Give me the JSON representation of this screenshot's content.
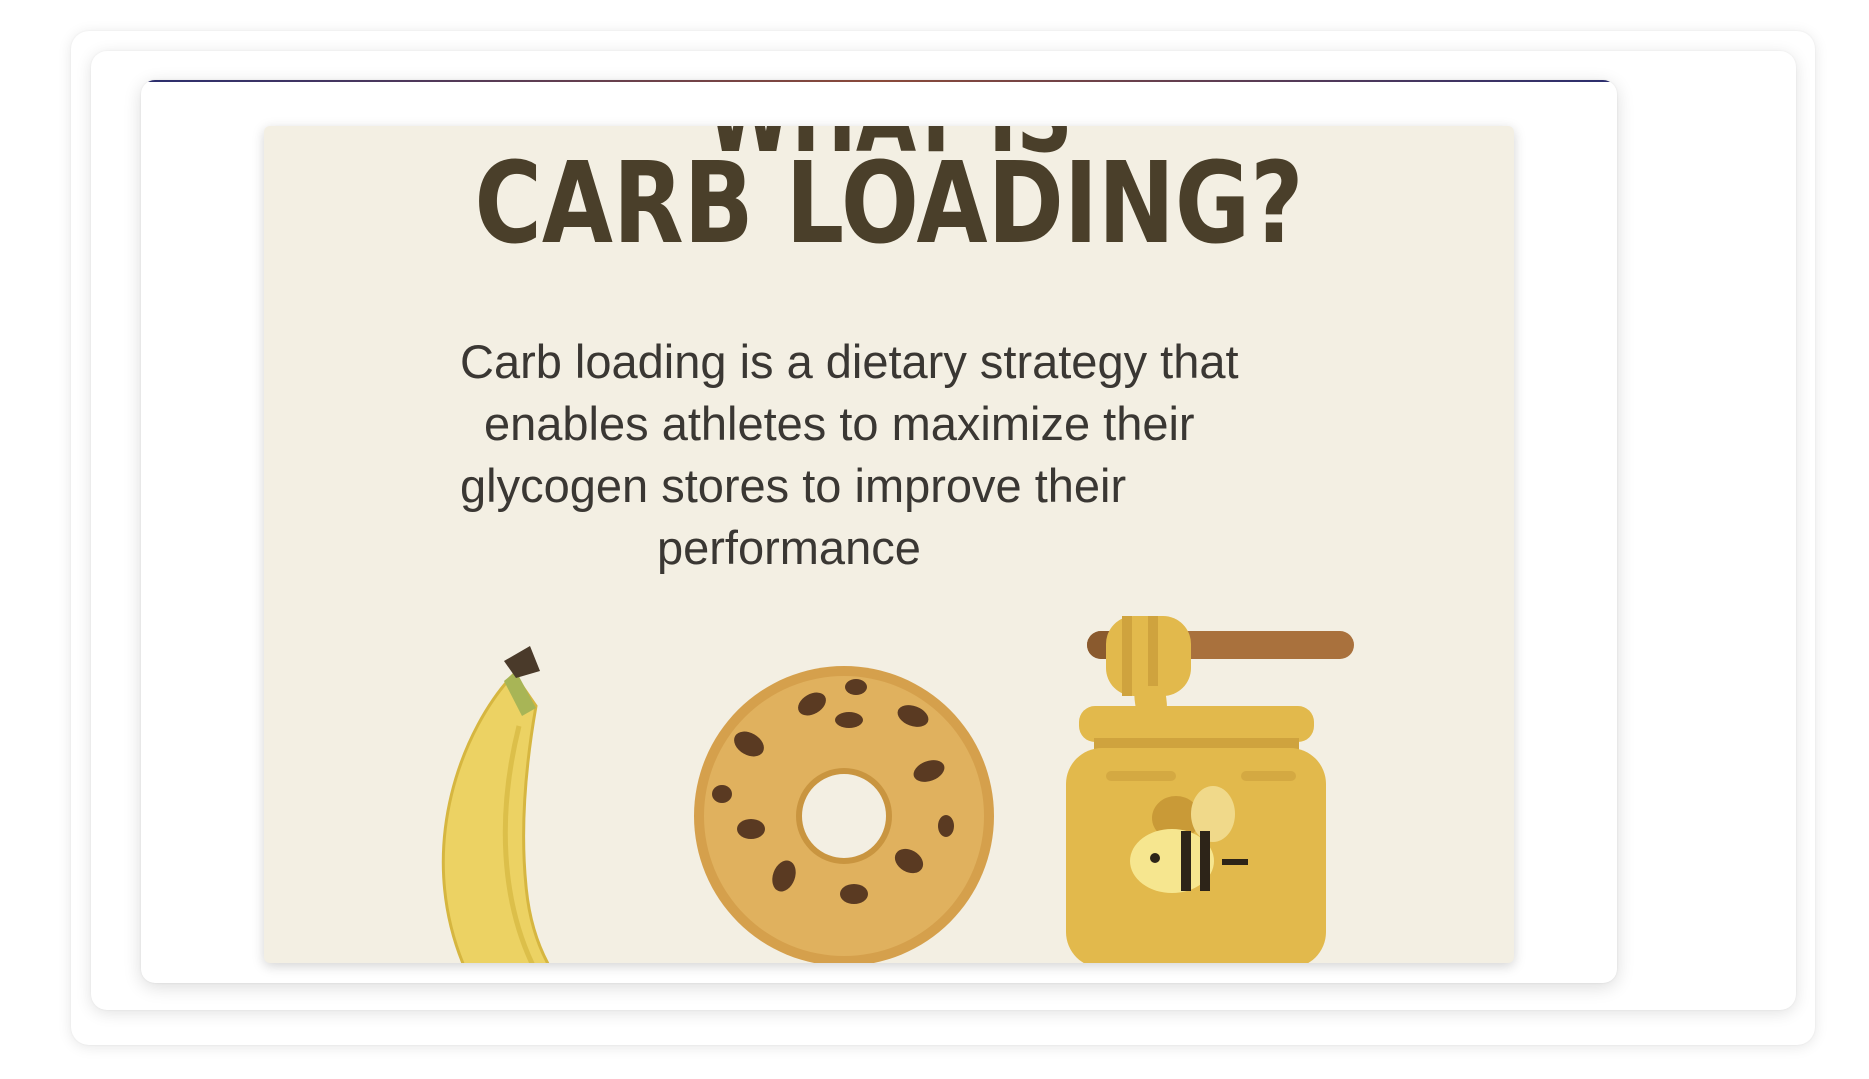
{
  "poster": {
    "heading_cut": "WHAT IS",
    "heading": "CARB LOADING?",
    "body_lines": [
      "Carb loading is a dietary strategy that",
      "enables athletes to maximize their",
      "glycogen stores to improve their",
      "performance"
    ],
    "illustrations": [
      "banana-icon",
      "bagel-icon",
      "honey-jar-icon",
      "honey-dipper-icon",
      "bee-icon"
    ]
  },
  "colors": {
    "poster_bg": "#f3efe3",
    "heading": "#4a3f2a",
    "body_text": "#3a3733",
    "accent_line_start": "#2b2e6e",
    "accent_line_mid": "#8a4a3a",
    "banana": "#ecd263",
    "bagel": "#d5a04c",
    "honey": "#e2b94c",
    "dipper": "#a9713d"
  }
}
